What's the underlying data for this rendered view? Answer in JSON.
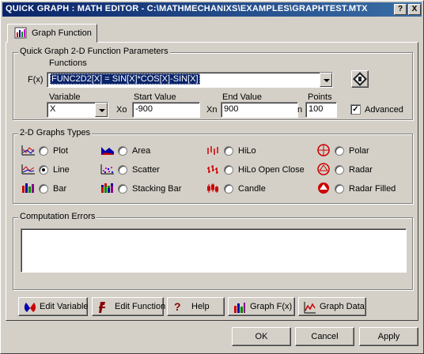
{
  "window": {
    "title": "QUICK GRAPH : MATH EDITOR - C:\\MATHMECHANIXS\\EXAMPLES\\GRAPHTEST.MTX",
    "help_btn": "?",
    "close_btn": "X"
  },
  "tab": {
    "label": "Graph Function"
  },
  "params": {
    "legend": "Quick Graph 2-D Function Parameters",
    "functions_label": "Functions",
    "fx_label": "F(x)",
    "function_value": "FUNC2D2[X] = SIN[X]*COS[X]-SIN[X]",
    "variable_label": "Variable",
    "variable_value": "X",
    "start_label": "Start Value",
    "start_prefix": "Xo",
    "start_value": "-900",
    "end_label": "End Value",
    "end_prefix": "Xn",
    "end_value": "900",
    "points_label": "Points",
    "points_prefix": "n",
    "points_value": "100",
    "advanced_label": "Advanced",
    "advanced_checked": true
  },
  "types": {
    "legend": "2-D Graphs Types",
    "selected": "Line",
    "options": [
      {
        "label": "Plot",
        "icon": "plot-graph-icon"
      },
      {
        "label": "Line",
        "icon": "line-graph-icon"
      },
      {
        "label": "Bar",
        "icon": "bar-graph-icon"
      },
      {
        "label": "Area",
        "icon": "area-graph-icon"
      },
      {
        "label": "Scatter",
        "icon": "scatter-graph-icon"
      },
      {
        "label": "Stacking Bar",
        "icon": "stacking-bar-graph-icon"
      },
      {
        "label": "HiLo",
        "icon": "hilo-graph-icon"
      },
      {
        "label": "HiLo Open Close",
        "icon": "hilo-open-close-graph-icon"
      },
      {
        "label": "Candle",
        "icon": "candle-graph-icon"
      },
      {
        "label": "Polar",
        "icon": "polar-graph-icon"
      },
      {
        "label": "Radar",
        "icon": "radar-graph-icon"
      },
      {
        "label": "Radar Filled",
        "icon": "radar-filled-graph-icon"
      }
    ]
  },
  "errors": {
    "legend": "Computation Errors",
    "text": ""
  },
  "toolbar": {
    "edit_variable": "Edit Variable",
    "edit_function": "Edit Function",
    "help": "Help",
    "graph_fx": "Graph F(x)",
    "graph_data": "Graph Data"
  },
  "footer": {
    "ok": "OK",
    "cancel": "Cancel",
    "apply": "Apply"
  }
}
